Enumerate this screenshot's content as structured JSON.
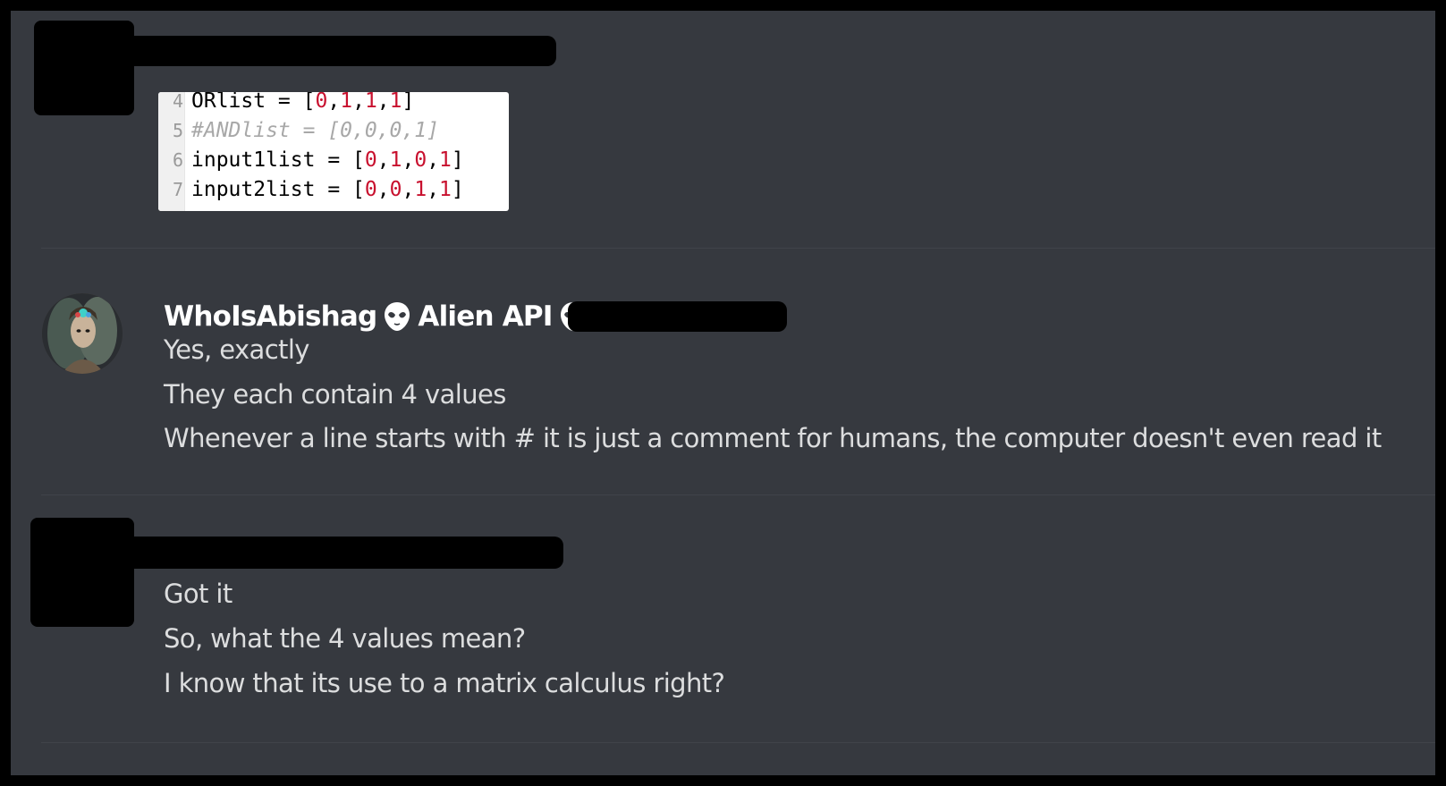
{
  "messages": [
    {
      "author_redacted": true,
      "code_image": {
        "lines": [
          {
            "number": "4",
            "text": "ORlist = [0,1,1,1]",
            "comment": false
          },
          {
            "number": "5",
            "text": "#ANDlist = [0,0,0,1]",
            "comment": true
          },
          {
            "number": "6",
            "text": "input1list = [0,1,0,1]",
            "comment": false
          },
          {
            "number": "7",
            "text": "input2list = [0,0,1,1]",
            "comment": false
          }
        ]
      }
    },
    {
      "author": "WhoIsAbishag",
      "role_label": "Alien API",
      "badge_icon": "alien-icon",
      "lines": [
        "Yes, exactly",
        "They each contain 4 values",
        "Whenever a line starts with # it is just a comment for humans, the computer doesn't even read it"
      ]
    },
    {
      "author_redacted": true,
      "lines": [
        "Got it",
        "So, what the 4 values mean?",
        "I know that its use to a matrix calculus right?"
      ]
    }
  ],
  "colors": {
    "background": "#36393f",
    "text": "#dcddde",
    "username": "#ffffff",
    "redaction": "#000000"
  }
}
